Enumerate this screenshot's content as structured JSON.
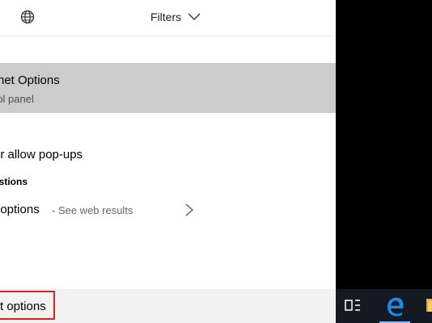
{
  "header": {
    "globe_icon": "globe-icon",
    "filters_label": "Filters",
    "filters_icon": "chevron-down-icon"
  },
  "best_match": {
    "title": "rnet Options",
    "subtitle": "rol panel"
  },
  "results": {
    "popups_label": "or allow pop-ups"
  },
  "suggestions": {
    "heading": "estions",
    "item": {
      "label": "t options",
      "separator_text": "- See web results",
      "icon": "chevron-right-icon"
    }
  },
  "search": {
    "value": "t options",
    "highlight_color": "#e02020"
  },
  "taskbar": {
    "items": [
      {
        "icon": "task-view-icon"
      },
      {
        "icon": "edge-icon"
      },
      {
        "icon": "file-explorer-icon"
      }
    ],
    "accent": "#1e88e5"
  }
}
